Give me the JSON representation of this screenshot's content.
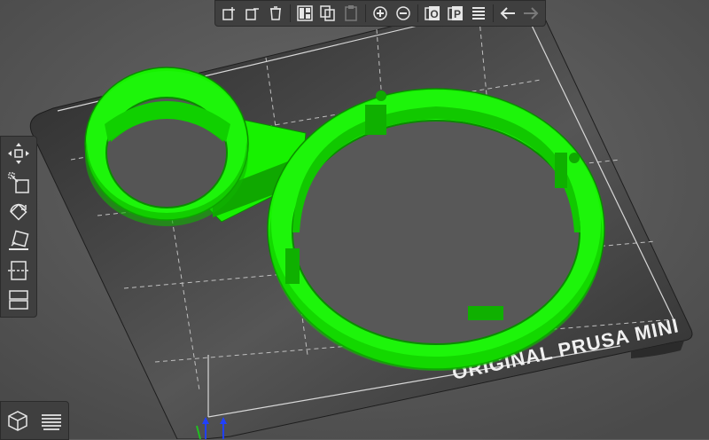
{
  "app": {
    "name": "PrusaSlicer 3D plater view"
  },
  "bed": {
    "label": "ORIGINAL PRUSA MINI",
    "color": "#272727",
    "grid_color": "#bfbfbf"
  },
  "model": {
    "color": "#17f200",
    "shade_color": "#0fa800",
    "description": "green dual-ring holder part"
  },
  "top_toolbar": {
    "items": [
      {
        "name": "add-icon",
        "enabled": true
      },
      {
        "name": "delete-icon",
        "enabled": true
      },
      {
        "name": "delete-all-icon",
        "enabled": true
      },
      {
        "name": "arrange-icon",
        "enabled": true
      },
      {
        "name": "copy-icon",
        "enabled": true
      },
      {
        "name": "paste-icon",
        "enabled": false
      },
      {
        "name": "instance-add-icon",
        "enabled": true
      },
      {
        "name": "instance-remove-icon",
        "enabled": true
      },
      {
        "name": "split-objects-icon",
        "label": "O",
        "enabled": true
      },
      {
        "name": "split-parts-icon",
        "label": "P",
        "enabled": true
      },
      {
        "name": "layers-editing-icon",
        "enabled": true
      },
      {
        "name": "undo-icon",
        "enabled": true
      },
      {
        "name": "redo-icon",
        "enabled": false
      }
    ]
  },
  "left_toolbar": {
    "items": [
      "move-icon",
      "scale-icon",
      "rotate-icon",
      "place-on-face-icon",
      "cut-icon",
      "support-painting-icon"
    ]
  },
  "view_toggle": {
    "items": [
      "3d-view-icon",
      "preview-icon"
    ]
  }
}
